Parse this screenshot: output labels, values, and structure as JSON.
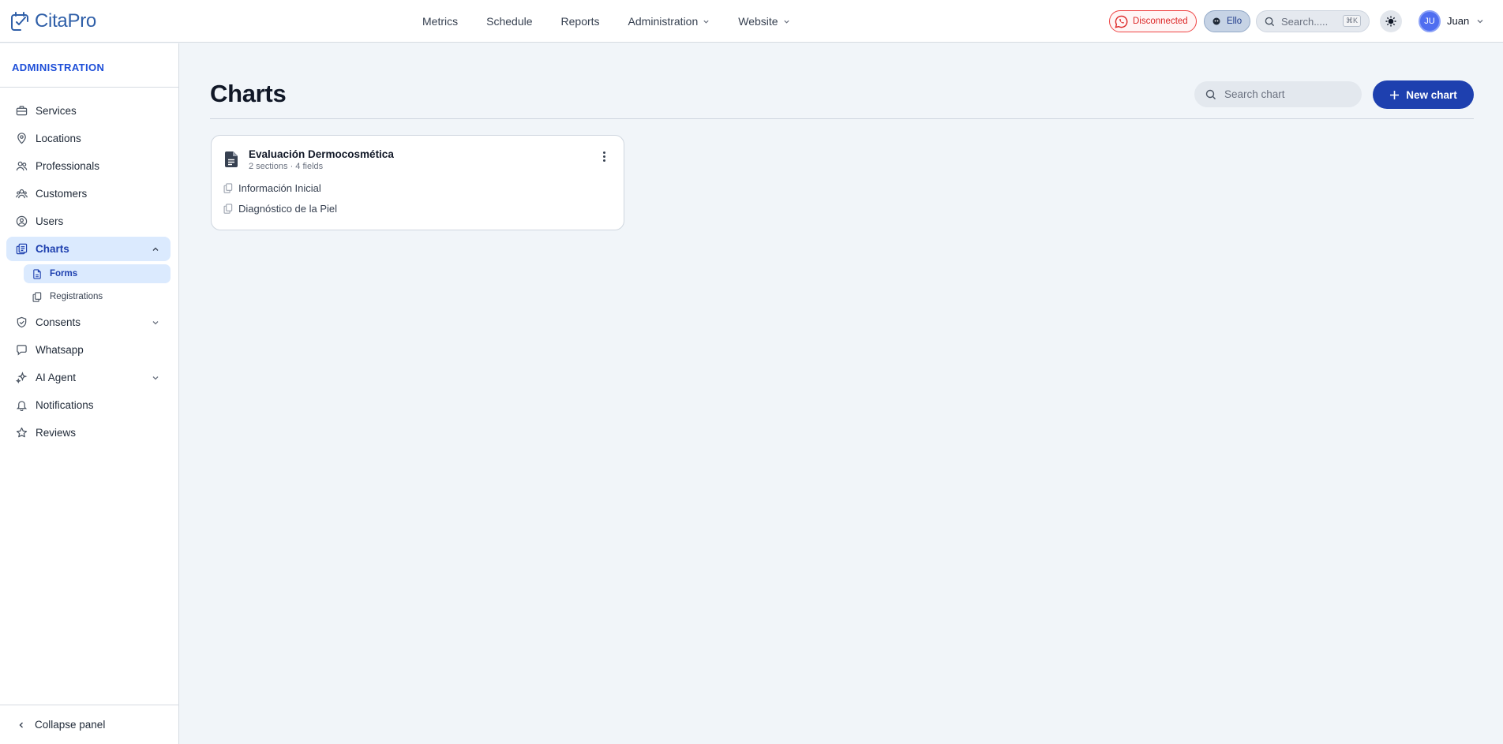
{
  "app": {
    "name": "CitaPro"
  },
  "topnav": [
    {
      "label": "Metrics",
      "dropdown": false
    },
    {
      "label": "Schedule",
      "dropdown": false
    },
    {
      "label": "Reports",
      "dropdown": false
    },
    {
      "label": "Administration",
      "dropdown": true
    },
    {
      "label": "Website",
      "dropdown": true
    }
  ],
  "header": {
    "whatsapp_status": "Disconnected",
    "assistant_label": "Ello",
    "search_placeholder": "Search.....",
    "search_shortcut": "⌘K",
    "user_initials": "JU",
    "user_name": "Juan"
  },
  "sidebar": {
    "title": "ADMINISTRATION",
    "items": [
      {
        "label": "Services",
        "icon": "briefcase-icon"
      },
      {
        "label": "Locations",
        "icon": "map-pin-icon"
      },
      {
        "label": "Professionals",
        "icon": "users-icon"
      },
      {
        "label": "Customers",
        "icon": "customers-icon"
      },
      {
        "label": "Users",
        "icon": "user-circle-icon"
      },
      {
        "label": "Charts",
        "icon": "charts-icon"
      },
      {
        "label": "Consents",
        "icon": "shield-check-icon"
      },
      {
        "label": "Whatsapp",
        "icon": "chat-icon"
      },
      {
        "label": "AI Agent",
        "icon": "sparkles-icon"
      },
      {
        "label": "Notifications",
        "icon": "bell-icon"
      },
      {
        "label": "Reviews",
        "icon": "star-icon"
      }
    ],
    "charts_sub": [
      {
        "label": "Forms"
      },
      {
        "label": "Registrations"
      }
    ],
    "collapse_label": "Collapse panel"
  },
  "main": {
    "title": "Charts",
    "search_placeholder": "Search chart",
    "new_button": "New chart"
  },
  "cards": [
    {
      "title": "Evaluación Dermocosmética",
      "meta": "2 sections · 4 fields",
      "sections": [
        "Información Inicial",
        "Diagnóstico de la Piel"
      ]
    }
  ],
  "colors": {
    "accent": "#1e40af",
    "active_bg": "#dbeafe",
    "danger": "#dc2626",
    "background": "#f1f5f9"
  }
}
